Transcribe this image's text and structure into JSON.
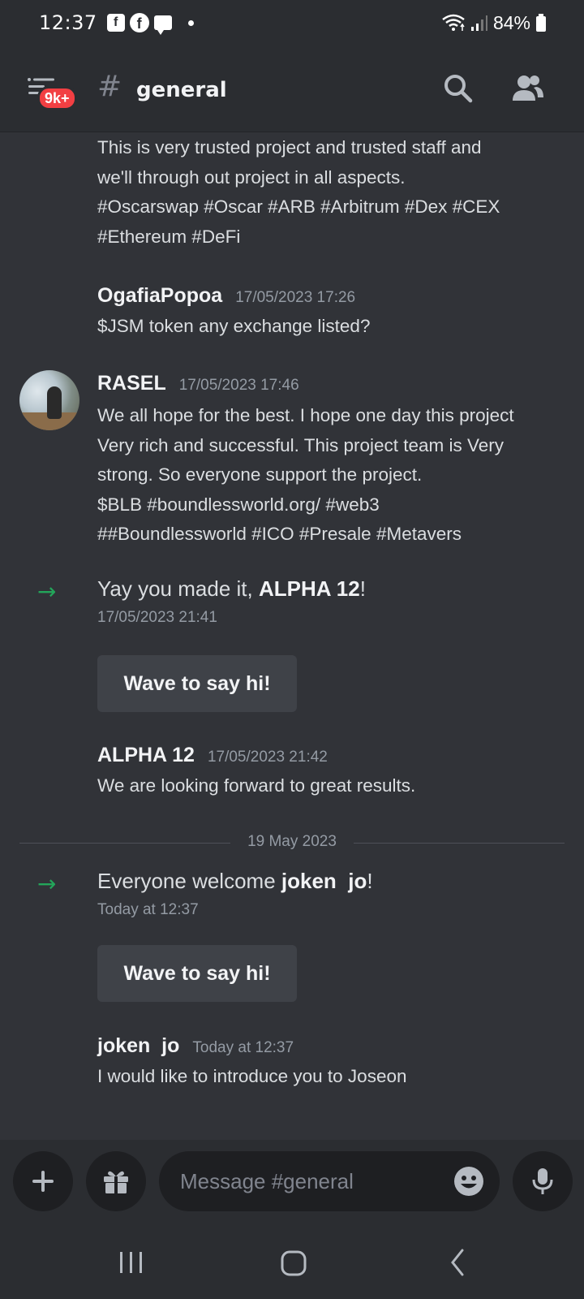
{
  "status_bar": {
    "time": "12:37",
    "notif_icons": [
      "facebook-square-icon",
      "facebook-icon",
      "chat-icon"
    ],
    "battery": "84%"
  },
  "header": {
    "badge": "9k+",
    "hash": "#",
    "channel": "general"
  },
  "messages": [
    {
      "type": "continuation",
      "text_lines": [
        "This is very trusted project and trusted staff and",
        "we'll through out project in all aspects.",
        "#Oscarswap #Oscar #ARB #Arbitrum #Dex #CEX",
        "#Ethereum #DeFi"
      ]
    },
    {
      "type": "message",
      "author": "OgafiaPopoa",
      "timestamp": "17/05/2023 17:26",
      "text_lines": [
        "$JSM token any exchange listed?"
      ]
    },
    {
      "type": "message",
      "author": "RASEL",
      "timestamp": "17/05/2023 17:46",
      "text_lines": [
        "We all hope for the best. I hope one day this project",
        "Very rich and successful. This project team is Very",
        "strong. So everyone support the project.",
        "$BLB #boundlessworld.org/ #web3",
        "##Boundlessworld #ICO #Presale #Metavers"
      ]
    },
    {
      "type": "join",
      "prefix": "Yay you made it, ",
      "name": "ALPHA 12",
      "suffix": "!",
      "timestamp": "17/05/2023 21:41",
      "wave_label": "Wave to say hi!"
    },
    {
      "type": "message",
      "author": "ALPHA 12",
      "timestamp": "17/05/2023 21:42",
      "text_lines": [
        "We are looking forward to great results."
      ]
    },
    {
      "type": "date_divider",
      "label": "19 May 2023"
    },
    {
      "type": "join",
      "prefix": "Everyone welcome ",
      "name": "joken  jo",
      "suffix": "!",
      "timestamp": "Today at 12:37",
      "wave_label": "Wave to say hi!"
    },
    {
      "type": "message",
      "author": "joken  jo",
      "timestamp": "Today at 12:37",
      "text_lines": [
        "I would like to introduce you to Joseon"
      ]
    }
  ],
  "input": {
    "placeholder": "Message #general"
  },
  "colors": {
    "background": "#313338",
    "header": "#2b2d31",
    "badge": "#f23f43",
    "join_arrow": "#23a55a",
    "button": "#3f4248"
  }
}
